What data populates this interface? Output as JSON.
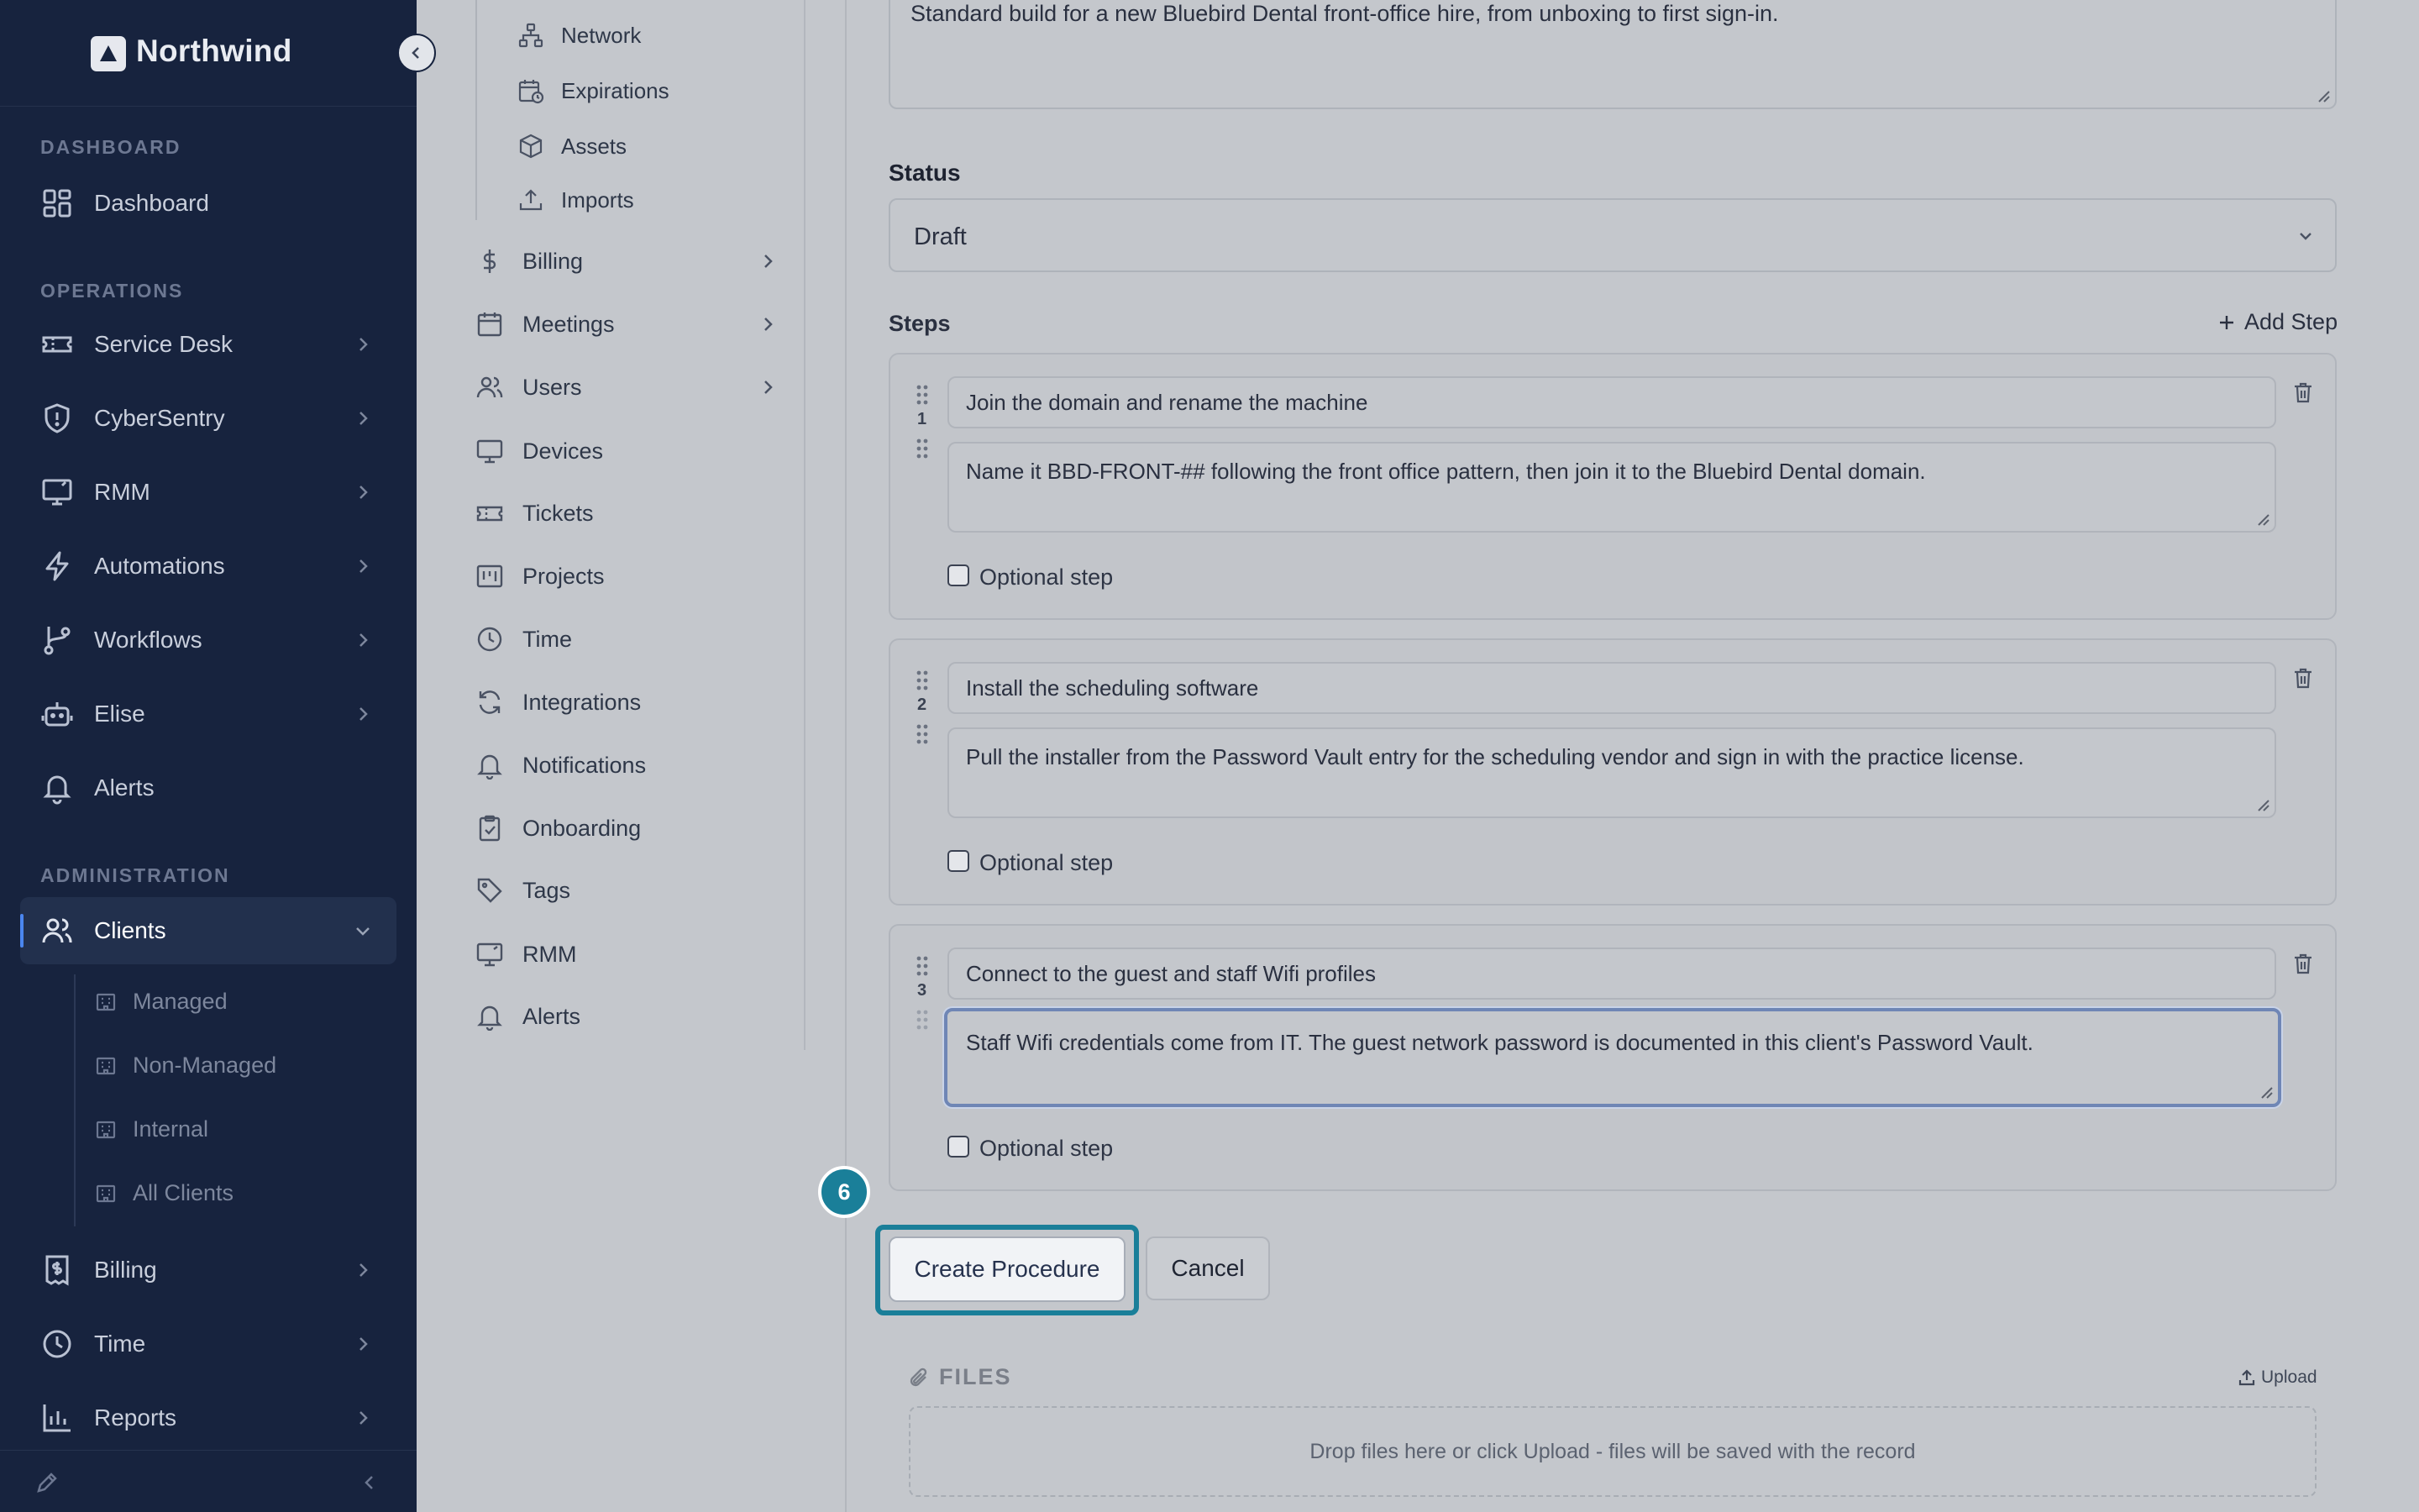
{
  "app": {
    "name": "Northwind"
  },
  "sidebar": {
    "sections": {
      "dashboard": "DASHBOARD",
      "operations": "OPERATIONS",
      "administration": "ADMINISTRATION"
    },
    "items": {
      "dashboard": "Dashboard",
      "service_desk": "Service Desk",
      "cybersentry": "CyberSentry",
      "rmm": "RMM",
      "automations": "Automations",
      "workflows": "Workflows",
      "elise": "Elise",
      "alerts": "Alerts",
      "clients": "Clients",
      "billing": "Billing",
      "time": "Time",
      "reports": "Reports"
    },
    "clients_sub": {
      "managed": "Managed",
      "non_managed": "Non-Managed",
      "internal": "Internal",
      "all_clients": "All Clients"
    }
  },
  "submenu": {
    "children": {
      "network": "Network",
      "expirations": "Expirations",
      "assets": "Assets",
      "imports": "Imports"
    },
    "items": {
      "billing": "Billing",
      "meetings": "Meetings",
      "users": "Users",
      "devices": "Devices",
      "tickets": "Tickets",
      "projects": "Projects",
      "time": "Time",
      "integrations": "Integrations",
      "notifications": "Notifications",
      "onboarding": "Onboarding",
      "tags": "Tags",
      "rmm": "RMM",
      "alerts": "Alerts"
    }
  },
  "form": {
    "description_value": "Standard build for a new Bluebird Dental front-office hire, from unboxing to first sign-in.",
    "status_label": "Status",
    "status_value": "Draft",
    "steps_label": "Steps",
    "add_step_label": "Add Step",
    "optional_label": "Optional step",
    "steps": [
      {
        "number": "1",
        "title": "Join the domain and rename the machine",
        "description": "Name it BBD-FRONT-## following the front office pattern, then join it to the Bluebird Dental domain."
      },
      {
        "number": "2",
        "title": "Install the scheduling software",
        "description": "Pull the installer from the Password Vault entry for the scheduling vendor and sign in with the practice license."
      },
      {
        "number": "3",
        "title": "Connect to the guest and staff Wifi profiles",
        "description": "Staff Wifi credentials come from IT. The guest network password is documented in this client's Password Vault."
      }
    ],
    "create_label": "Create Procedure",
    "cancel_label": "Cancel",
    "highlight_badge": "6"
  },
  "files": {
    "title": "FILES",
    "upload_label": "Upload",
    "drop_hint": "Drop files here or click Upload - files will be saved with the record"
  },
  "colors": {
    "sidebar_bg": "#17233e",
    "highlight": "#1a7f99",
    "active_accent": "#4b86ef"
  }
}
